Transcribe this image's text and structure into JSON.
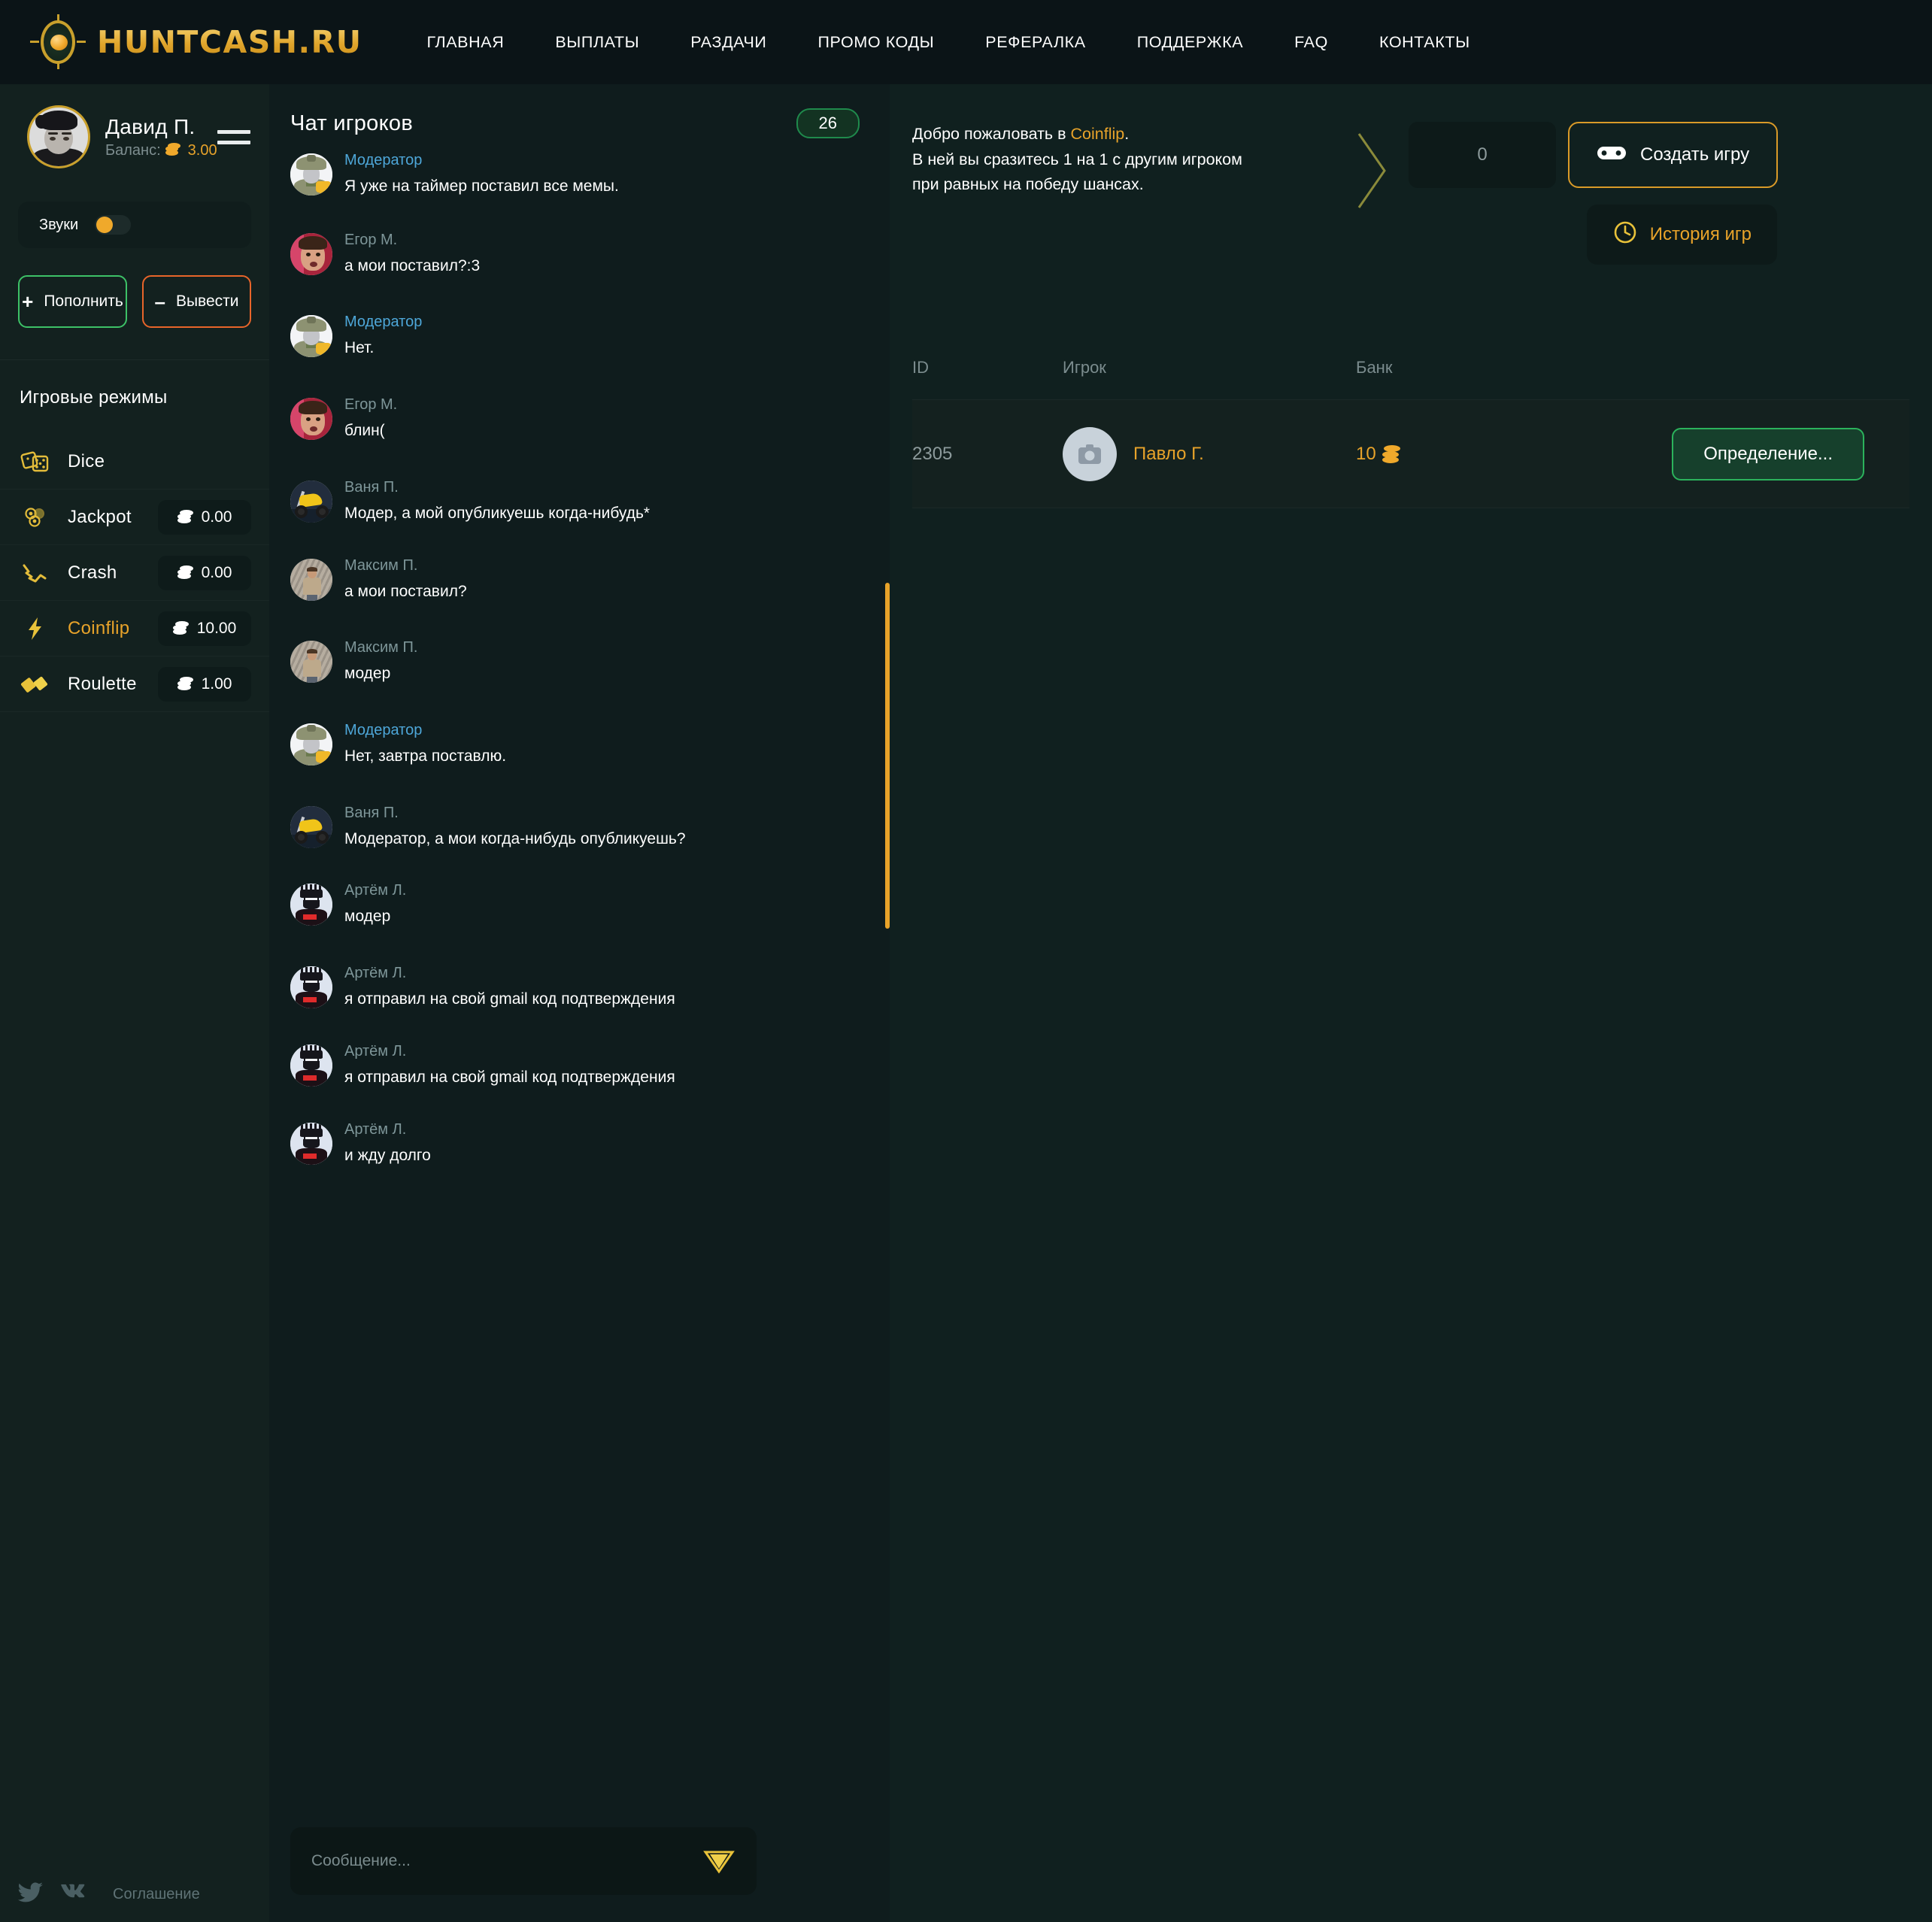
{
  "header": {
    "brand": "HUNTCASH.RU",
    "nav": [
      {
        "label": "ГЛАВНАЯ"
      },
      {
        "label": "ВЫПЛАТЫ"
      },
      {
        "label": "РАЗДАЧИ"
      },
      {
        "label": "ПРОМО КОДЫ"
      },
      {
        "label": "РЕФЕРАЛКА"
      },
      {
        "label": "ПОДДЕРЖКА"
      },
      {
        "label": "FAQ"
      },
      {
        "label": "КОНТАКТЫ"
      }
    ]
  },
  "sidebar": {
    "profile": {
      "name": "Давид П.",
      "balance_label": "Баланс:",
      "balance_value": "3.00"
    },
    "sound": {
      "label": "Звуки",
      "enabled": true
    },
    "deposit_button": {
      "sign": "+",
      "label": "Пополнить"
    },
    "withdraw_button": {
      "sign": "–",
      "label": "Вывести"
    },
    "modes_title": "Игровые режимы",
    "modes": [
      {
        "label": "Dice",
        "amount": "",
        "icon": "dice-icon",
        "active": false
      },
      {
        "label": "Jackpot",
        "amount": "0.00",
        "icon": "jackpot-icon",
        "active": false
      },
      {
        "label": "Crash",
        "amount": "0.00",
        "icon": "crash-icon",
        "active": false
      },
      {
        "label": "Coinflip",
        "amount": "10.00",
        "icon": "coinflip-icon",
        "active": true
      },
      {
        "label": "Roulette",
        "amount": "1.00",
        "icon": "roulette-icon",
        "active": false
      }
    ],
    "footer": {
      "twitter_icon": "twitter-icon",
      "vk_icon": "vk-icon",
      "agreement_link": "Соглашение"
    }
  },
  "chat": {
    "title": "Чат игроков",
    "online_count": "26",
    "input_placeholder": "Сообщение...",
    "input_value": "",
    "send_icon": "send-icon",
    "messages": [
      {
        "author": "Модератор",
        "is_mod": true,
        "avatar": "a-mod",
        "text": "Я уже на таймер поставил все мемы."
      },
      {
        "author": "Егор М.",
        "is_mod": false,
        "avatar": "a-egor",
        "text": "а мои поставил?:3"
      },
      {
        "author": "Модератор",
        "is_mod": true,
        "avatar": "a-mod",
        "text": "Нет."
      },
      {
        "author": "Егор М.",
        "is_mod": false,
        "avatar": "a-egor",
        "text": "блин("
      },
      {
        "author": "Ваня П.",
        "is_mod": false,
        "avatar": "a-vanya",
        "text": "Модер, а мой опубликуешь когда-нибудь*"
      },
      {
        "author": "Максим П.",
        "is_mod": false,
        "avatar": "a-maxim",
        "text": "а мои поставил?"
      },
      {
        "author": "Максим П.",
        "is_mod": false,
        "avatar": "a-maxim",
        "text": "модер"
      },
      {
        "author": "Модератор",
        "is_mod": true,
        "avatar": "a-mod",
        "text": "Нет, завтра поставлю."
      },
      {
        "author": "Ваня П.",
        "is_mod": false,
        "avatar": "a-vanya",
        "text": "Модератор, а мои когда-нибудь опубликуешь?"
      },
      {
        "author": "Артём Л.",
        "is_mod": false,
        "avatar": "a-artem",
        "text": "модер"
      },
      {
        "author": "Артём Л.",
        "is_mod": false,
        "avatar": "a-artem",
        "text": "я отправил на свой gmail код подтверждения"
      },
      {
        "author": "Артём Л.",
        "is_mod": false,
        "avatar": "a-artem",
        "text": "я отправил на свой gmail код подтверждения"
      },
      {
        "author": "Артём Л.",
        "is_mod": false,
        "avatar": "a-artem",
        "text": "и жду долго"
      }
    ]
  },
  "main": {
    "welcome_line1_prefix": "Добро пожаловать в ",
    "welcome_link": "Coinflip",
    "welcome_line1_suffix": ".",
    "welcome_line2": "В ней вы сразитесь 1 на 1 с другим игроком",
    "welcome_line3": "при равных на победу шансах.",
    "bet_value": "0",
    "create_game_button": "Создать игру",
    "create_game_icon": "gamepad-icon",
    "history_button": "История игр",
    "history_icon": "clock-icon",
    "table": {
      "columns": [
        "ID",
        "Игрок",
        "Банк",
        ""
      ],
      "rows": [
        {
          "id": "2305",
          "player": "Павло Г.",
          "avatar_icon": "camera-placeholder-icon",
          "bank": "10",
          "action_label": "Определение..."
        }
      ]
    }
  },
  "colors": {
    "accent_gold": "#e8a32a",
    "accent_green": "#2bb35c",
    "accent_orange": "#e8652a",
    "mod_blue": "#4ea7d9",
    "bg_dark": "#0b1417",
    "bg_panel": "#13211f"
  }
}
